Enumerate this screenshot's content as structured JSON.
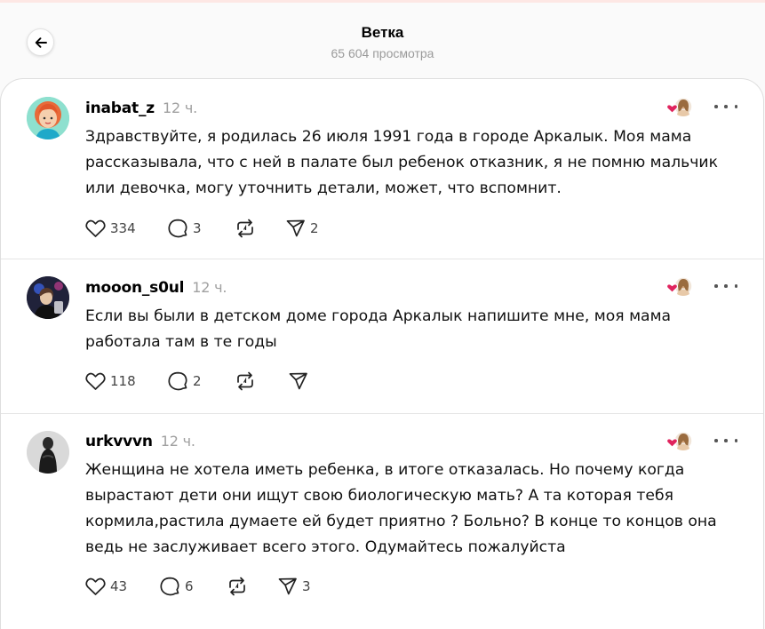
{
  "header": {
    "title": "Ветка",
    "views": "65 604 просмотра"
  },
  "posts": [
    {
      "username": "inabat_z",
      "time": "12 ч.",
      "text": "Здравствуйте, я родилась 26 июля 1991 года в городе Аркалык. Моя мама рассказывала, что с ней в палате был ребенок отказник, я не помню мальчик или девочка, могу уточнить детали, может, что вспомнит.",
      "likes": "334",
      "replies": "3",
      "shares": "2"
    },
    {
      "username": "mooon_s0ul",
      "time": "12 ч.",
      "text": "Если вы были в детском доме города Аркалык напишите мне, моя мама работала там в те годы",
      "likes": "118",
      "replies": "2",
      "shares": ""
    },
    {
      "username": "urkvvvn",
      "time": "12 ч.",
      "text": "Женщина не хотела иметь ребенка, в итоге отказалась. Но почему когда вырастают дети они ищут свою биологическую мать? А та которая тебя кормила,растила думаете ей будет приятно ? Больно? В конце то концов она ведь не заслуживает всего этого. Одумайтесь пожалуйста",
      "likes": "43",
      "replies": "6",
      "shares": "3"
    }
  ],
  "icons": {
    "back": "arrow-left-icon",
    "like": "heart-icon",
    "reply": "comment-icon",
    "repost": "repost-icon",
    "share": "send-icon",
    "more": "more-icon",
    "liked_by": "liked-by-author-icon"
  },
  "colors": {
    "liked_heart": "#e0245e",
    "secondary_text": "#9a9a9a"
  }
}
